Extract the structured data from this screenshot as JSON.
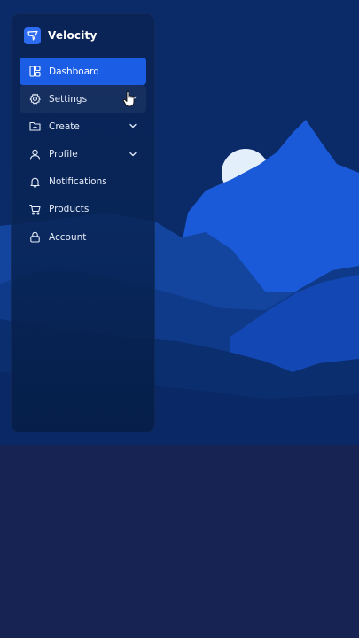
{
  "app": {
    "name": "Velocity",
    "accent": "#1c5de6"
  },
  "sidebar": {
    "items": [
      {
        "id": "dashboard",
        "label": "Dashboard",
        "icon": "layout-icon",
        "active": true,
        "has_submenu": false
      },
      {
        "id": "settings",
        "label": "Settings",
        "icon": "gear-icon",
        "active": false,
        "has_submenu": true,
        "hovered": true
      },
      {
        "id": "create",
        "label": "Create",
        "icon": "folder-plus-icon",
        "active": false,
        "has_submenu": true
      },
      {
        "id": "profile",
        "label": "Profile",
        "icon": "user-icon",
        "active": false,
        "has_submenu": true
      },
      {
        "id": "notifications",
        "label": "Notifications",
        "icon": "bell-icon",
        "active": false,
        "has_submenu": false
      },
      {
        "id": "products",
        "label": "Products",
        "icon": "cart-icon",
        "active": false,
        "has_submenu": false
      },
      {
        "id": "account",
        "label": "Account",
        "icon": "lock-icon",
        "active": false,
        "has_submenu": false
      }
    ]
  },
  "colors": {
    "page_bg": "#172353",
    "sky": "#0b2b68",
    "moon": "#e3effb",
    "mountain_bright": "#1a5ad8"
  }
}
